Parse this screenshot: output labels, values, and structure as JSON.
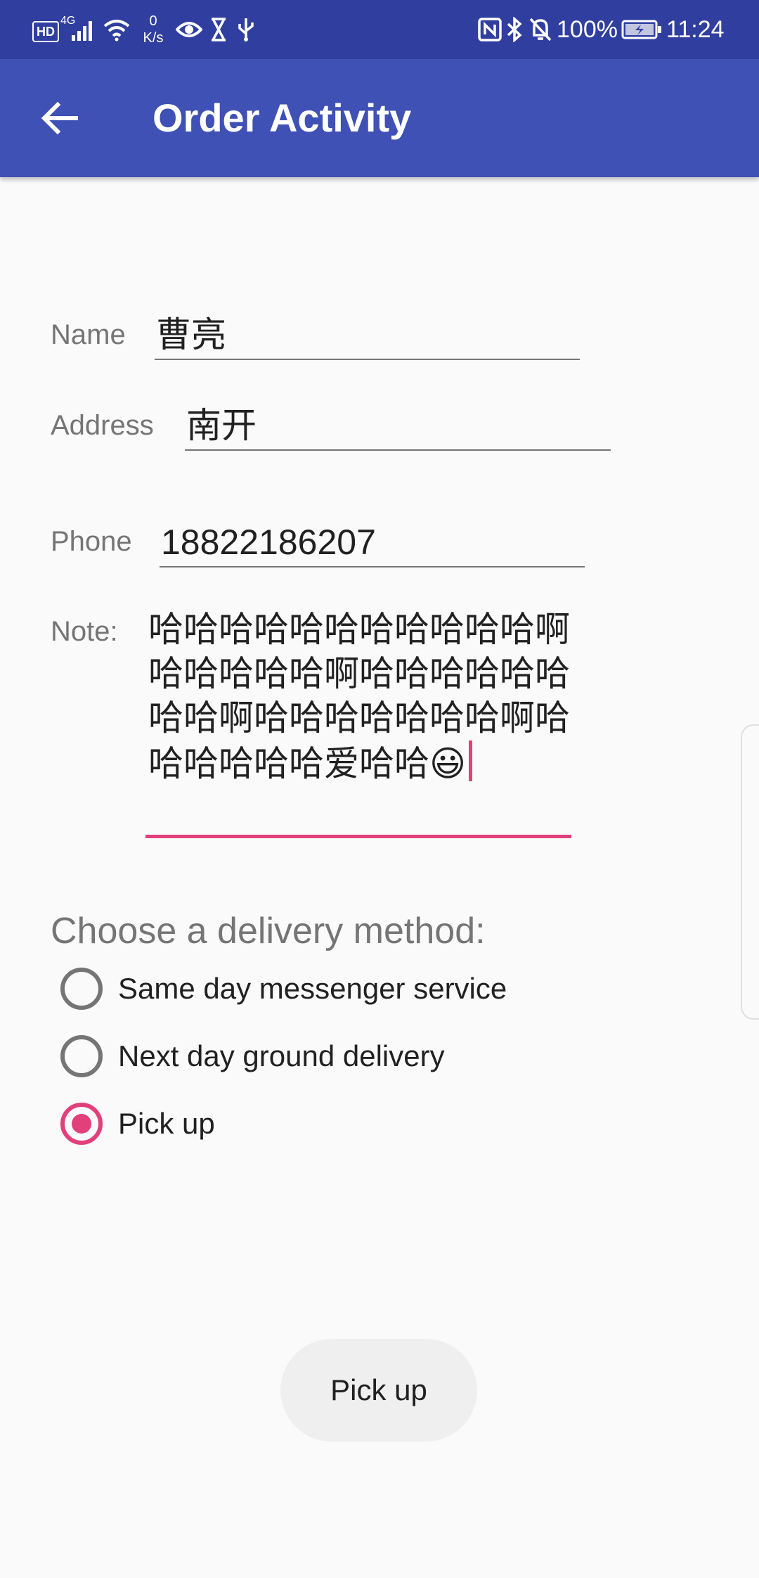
{
  "status_bar": {
    "hd": "HD",
    "network": "4G",
    "speed_value": "0",
    "speed_unit": "K/s",
    "battery": "100%",
    "time": "11:24",
    "icons": [
      "signal-icon",
      "wifi-icon",
      "eye-icon",
      "hourglass-icon",
      "usb-icon",
      "nfc-icon",
      "bluetooth-icon",
      "mute-bell-icon",
      "battery-icon"
    ]
  },
  "app_bar": {
    "title": "Order Activity",
    "back_icon": "back-arrow-icon"
  },
  "form": {
    "name": {
      "label": "Name",
      "value": "曹亮"
    },
    "address": {
      "label": "Address",
      "value": "南开"
    },
    "phone": {
      "label": "Phone",
      "value": "18822186207"
    },
    "note": {
      "label": "Note:",
      "value": "哈哈哈哈哈哈哈哈哈哈哈啊哈哈哈哈哈啊哈哈哈哈哈哈哈哈啊哈哈哈哈哈哈哈啊哈哈哈哈哈哈爱哈哈😃"
    }
  },
  "delivery": {
    "title": "Choose a delivery method:",
    "options": [
      {
        "label": "Same day messenger service",
        "checked": false
      },
      {
        "label": "Next day ground delivery",
        "checked": false
      },
      {
        "label": "Pick up",
        "checked": true
      }
    ]
  },
  "submit_button": {
    "label": "Pick up"
  },
  "colors": {
    "status_bar": "#303F9F",
    "app_bar": "#3F51B5",
    "accent": "#E2407A",
    "background": "#FAFAFA"
  }
}
